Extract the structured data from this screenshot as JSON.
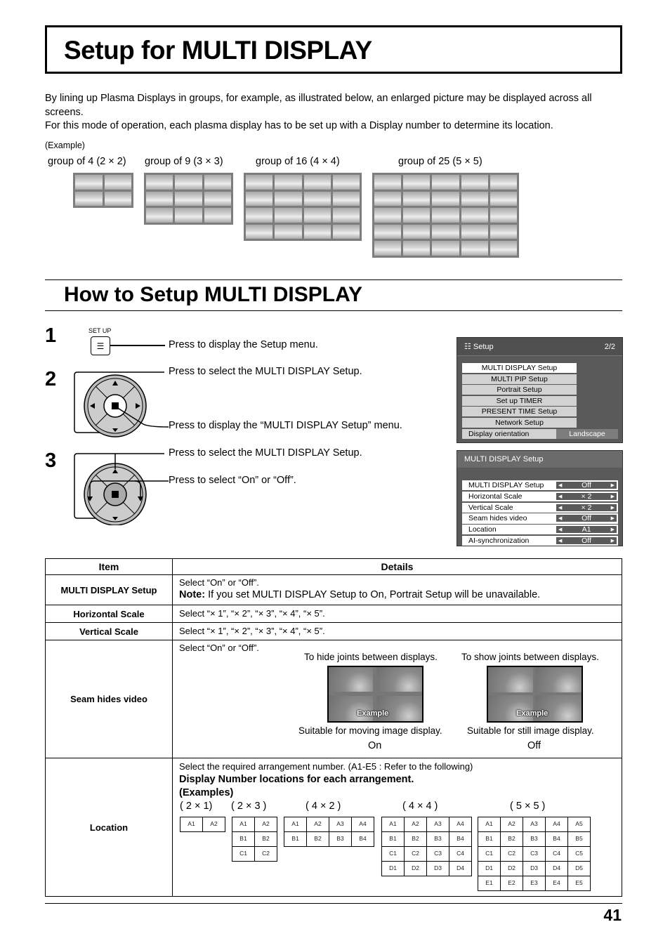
{
  "page": {
    "title": "Setup for MULTI DISPLAY",
    "intro": [
      "By lining up Plasma Displays in groups, for example, as illustrated below, an enlarged picture may be displayed across all screens.",
      "For this mode of operation, each plasma display has to be set up with a Display number to determine its location."
    ],
    "example_label": "(Example)",
    "groups": [
      {
        "label": "group of 4 (2 × 2)",
        "cols": 2,
        "rows": 2
      },
      {
        "label": "group of 9 (3 × 3)",
        "cols": 3,
        "rows": 3
      },
      {
        "label": "group of 16 (4 × 4)",
        "cols": 4,
        "rows": 4
      },
      {
        "label": "group of 25 (5 × 5)",
        "cols": 5,
        "rows": 5
      }
    ],
    "section_title": "How to Setup MULTI DISPLAY",
    "page_number": "41"
  },
  "steps": [
    {
      "num": "1",
      "button_label": "SET UP",
      "texts": [
        "Press to display the Setup menu."
      ]
    },
    {
      "num": "2",
      "texts": [
        "Press to select the MULTI DISPLAY Setup.",
        "Press to display the “MULTI DISPLAY Setup” menu."
      ]
    },
    {
      "num": "3",
      "texts": [
        "Press to select the MULTI DISPLAY Setup.",
        "Press to select “On” or “Off”."
      ]
    }
  ],
  "osd_setup": {
    "title": "Setup",
    "page": "2/2",
    "items": [
      "MULTI DISPLAY Setup",
      "MULTI PIP Setup",
      "Portrait Setup",
      "Set up TIMER",
      "PRESENT TIME Setup",
      "Network Setup"
    ],
    "selected_index": 0,
    "orientation_label": "Display orientation",
    "orientation_value": "Landscape"
  },
  "osd_multi": {
    "title": "MULTI DISPLAY Setup",
    "rows": [
      {
        "label": "MULTI DISPLAY Setup",
        "value": "Off"
      },
      {
        "label": "Horizontal Scale",
        "value": "× 2"
      },
      {
        "label": "Vertical Scale",
        "value": "× 2"
      },
      {
        "label": "Seam hides video",
        "value": "Off"
      },
      {
        "label": "Location",
        "value": "A1"
      },
      {
        "label": "AI-synchronization",
        "value": "Off"
      }
    ]
  },
  "table": {
    "headers": [
      "Item",
      "Details"
    ],
    "multi_display": {
      "item": "MULTI DISPLAY Setup",
      "line1": "Select “On” or “Off”.",
      "note_label": "Note:",
      "note": " If you set MULTI DISPLAY Setup to On, Portrait Setup will be unavailable."
    },
    "horizontal": {
      "item": "Horizontal Scale",
      "detail": "Select “× 1”, “× 2”, “× 3”, “× 4”, “× 5”."
    },
    "vertical": {
      "item": "Vertical Scale",
      "detail": "Select “× 1”, “× 2”, “× 3”, “× 4”, “× 5”."
    },
    "seam": {
      "item": "Seam hides video",
      "detail": "Select “On” or “Off”.",
      "on_caption_top": "To hide joints between displays.",
      "off_caption_top": "To show joints between displays.",
      "on_caption_bottom": "Suitable for moving image display.",
      "off_caption_bottom": "Suitable for still image display.",
      "on_label": "On",
      "off_label": "Off",
      "image_text": "Example"
    },
    "location": {
      "item": "Location",
      "detail": "Select the required arrangement number. (A1-E5 : Refer to the following)",
      "heading1": "Display Number locations for each arrangement.",
      "heading2": "(Examples)",
      "arrangements": [
        {
          "label": "( 2 × 1)",
          "rows": [
            [
              "A1",
              "A2"
            ]
          ]
        },
        {
          "label": "( 2 × 3 )",
          "rows": [
            [
              "A1",
              "A2"
            ],
            [
              "B1",
              "B2"
            ],
            [
              "C1",
              "C2"
            ]
          ]
        },
        {
          "label": "( 4 × 2 )",
          "rows": [
            [
              "A1",
              "A2",
              "A3",
              "A4"
            ],
            [
              "B1",
              "B2",
              "B3",
              "B4"
            ]
          ]
        },
        {
          "label": "( 4 × 4 )",
          "rows": [
            [
              "A1",
              "A2",
              "A3",
              "A4"
            ],
            [
              "B1",
              "B2",
              "B3",
              "B4"
            ],
            [
              "C1",
              "C2",
              "C3",
              "C4"
            ],
            [
              "D1",
              "D2",
              "D3",
              "D4"
            ]
          ]
        },
        {
          "label": "( 5 × 5 )",
          "rows": [
            [
              "A1",
              "A2",
              "A3",
              "A4",
              "A5"
            ],
            [
              "B1",
              "B2",
              "B3",
              "B4",
              "B5"
            ],
            [
              "C1",
              "C2",
              "C3",
              "C4",
              "C5"
            ],
            [
              "D1",
              "D2",
              "D3",
              "D4",
              "D5"
            ],
            [
              "E1",
              "E2",
              "E3",
              "E4",
              "E5"
            ]
          ]
        }
      ]
    }
  }
}
